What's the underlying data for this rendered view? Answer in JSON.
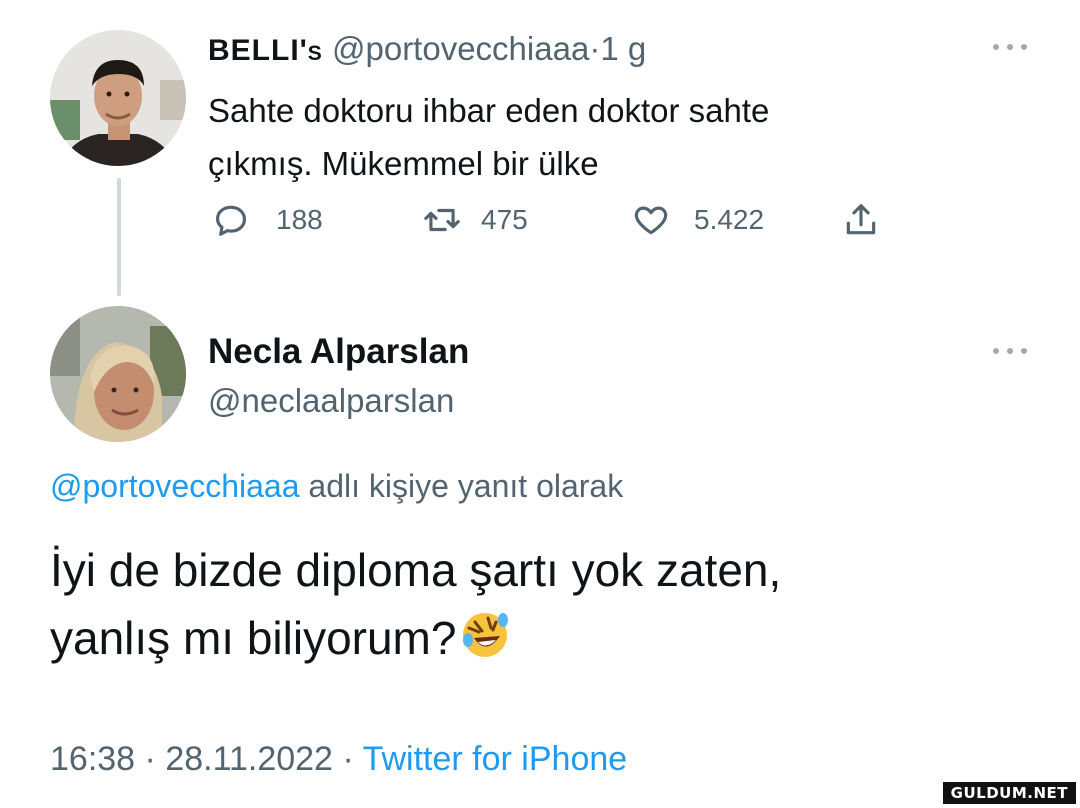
{
  "tweet1": {
    "display_name": "BELLI's",
    "handle": "@portovecchiaaa",
    "separator": "·",
    "time_ago": "1 g",
    "text_line1": "Sahte doktoru ihbar eden doktor sahte",
    "text_line2": "çıkmış. Mükemmel bir ülke",
    "replies": "188",
    "retweets": "475",
    "likes": "5.422",
    "avatar_icon": "avatar-man",
    "share_icon": "share-icon"
  },
  "tweet2": {
    "display_name": "Necla Alparslan",
    "handle": "@neclaalparslan",
    "reply_to_handle": "@portovecchiaaa",
    "reply_to_suffix": "adlı kişiye yanıt olarak",
    "text_line1": "İyi de bizde diploma şartı yok zaten,",
    "text_line2": "yanlış mı biliyorum?",
    "emoji": "rolling-on-floor-laughing",
    "time": "16:38",
    "date": "28.11.2022",
    "source": "Twitter for iPhone",
    "meta_sep": "·",
    "avatar_icon": "avatar-woman"
  },
  "watermark": "GULDUM.NET",
  "colors": {
    "text": "#0f1419",
    "secondary": "#536471",
    "link": "#1d9bf0",
    "thread_line": "#cfd9de"
  }
}
